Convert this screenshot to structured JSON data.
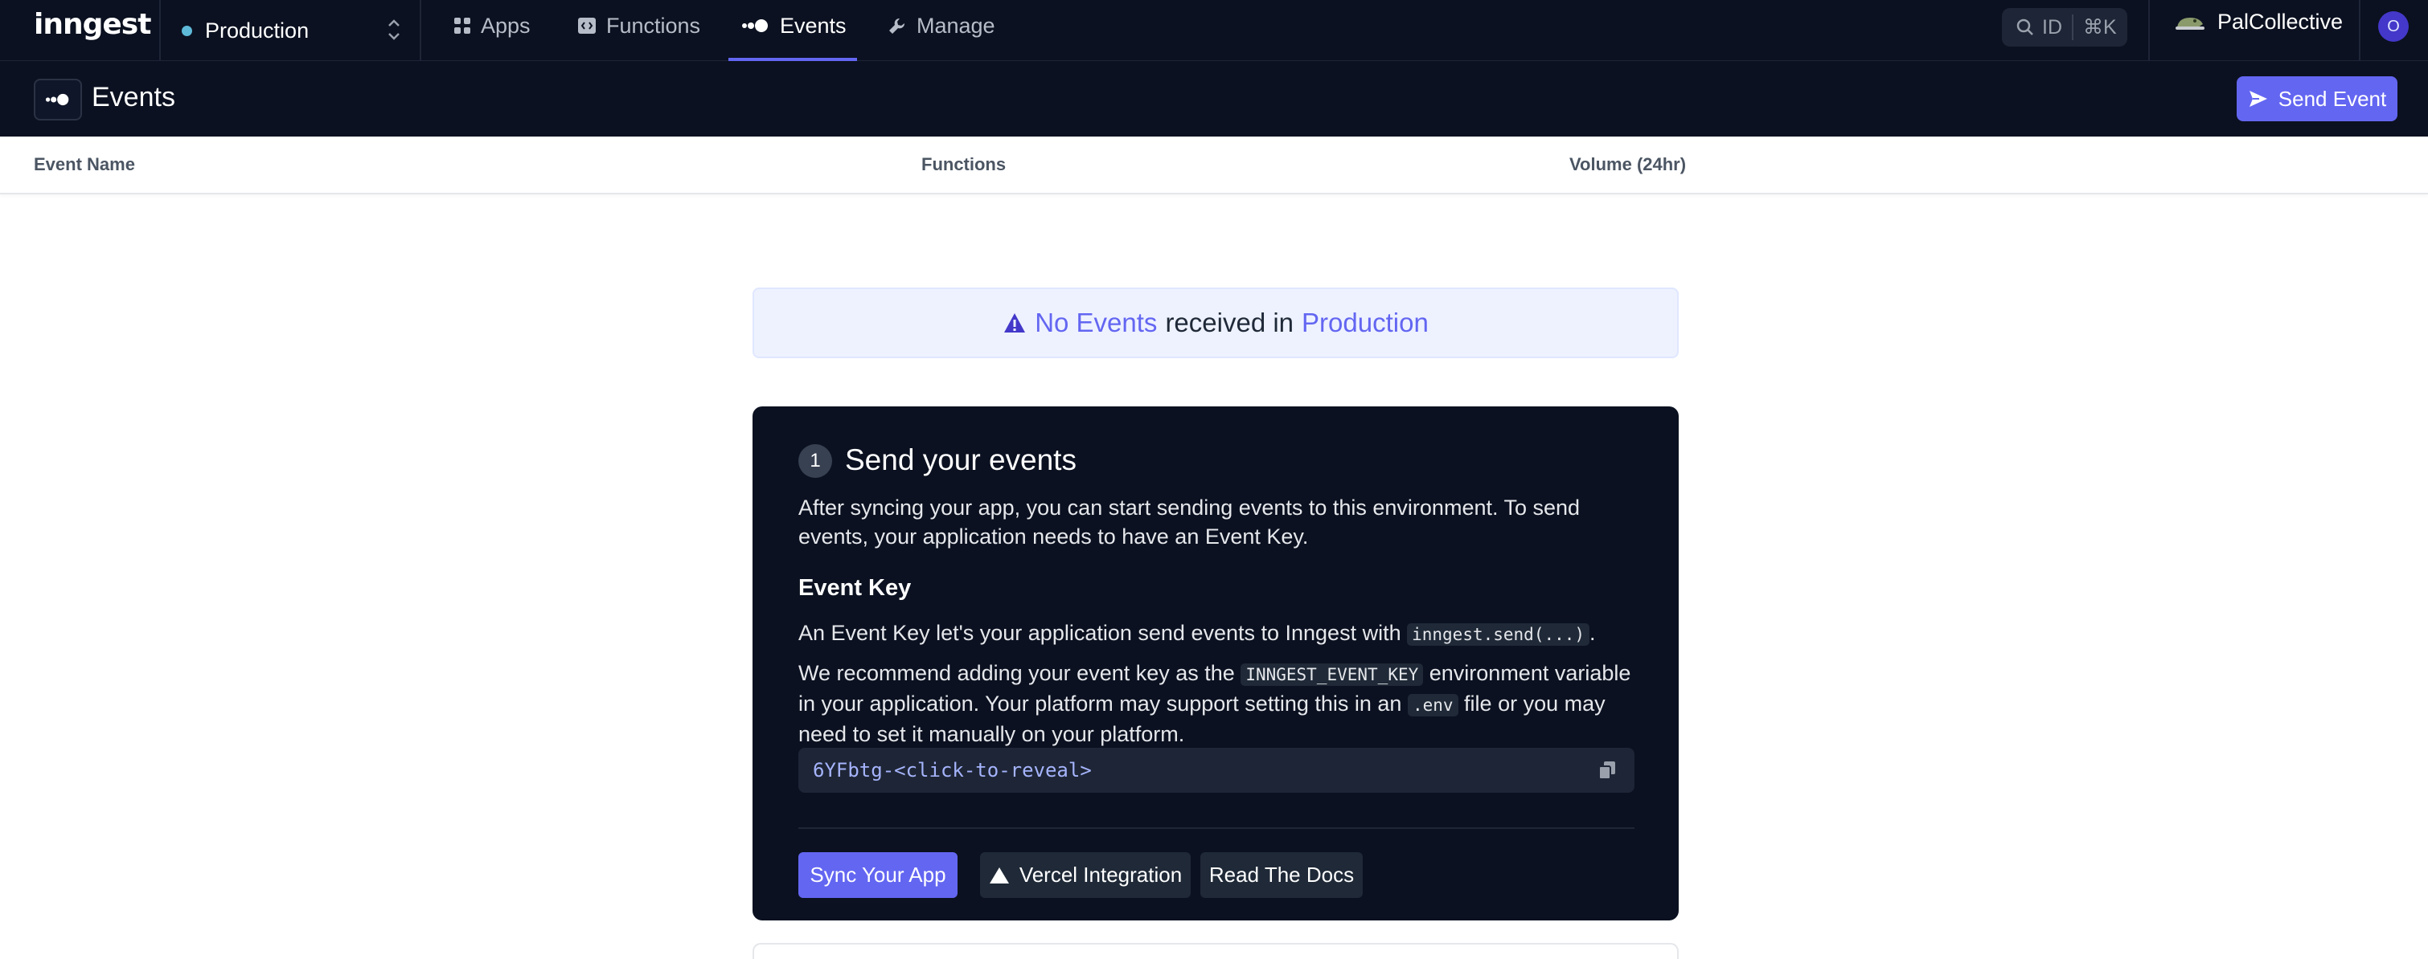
{
  "app": {
    "logo": "inngest"
  },
  "topnav": {
    "environment": "Production",
    "items": [
      {
        "label": "Apps",
        "icon": "grid-icon"
      },
      {
        "label": "Functions",
        "icon": "code-icon"
      },
      {
        "label": "Events",
        "icon": "events-icon",
        "active": true
      },
      {
        "label": "Manage",
        "icon": "wrench-icon"
      }
    ],
    "search": {
      "label": "ID",
      "shortcut": "⌘K"
    },
    "org_name": "PalCollective",
    "avatar_initial": "O"
  },
  "header": {
    "title": "Events",
    "send_button": "Send Event"
  },
  "table": {
    "columns": [
      "Event Name",
      "Functions",
      "Volume (24hr)"
    ]
  },
  "banner": {
    "part1": "No Events",
    "part2": "received in",
    "part3": "Production"
  },
  "card": {
    "step": "1",
    "title": "Send your events",
    "intro": "After syncing your app, you can start sending events to this environment. To send events, your application needs to have an Event Key.",
    "event_key_heading": "Event Key",
    "p2_before": "An Event Key let's your application send events to Inngest with",
    "p2_code": "inngest.send(...)",
    "p2_after": ".",
    "p3_a": "We recommend adding your event key as the",
    "p3_code1": "INNGEST_EVENT_KEY",
    "p3_b": "environment variable in your application. Your platform may support setting this in an",
    "p3_code2": ".env",
    "p3_c": "file or you may need to set it manually on your platform.",
    "key_value": "6YFbtg-<click-to-reveal>",
    "buttons": {
      "sync": "Sync Your App",
      "vercel": "Vercel Integration",
      "docs": "Read The Docs"
    }
  },
  "colors": {
    "nav_bg": "#0b1120",
    "accent": "#6366f1",
    "banner_bg": "#eef2ff"
  }
}
